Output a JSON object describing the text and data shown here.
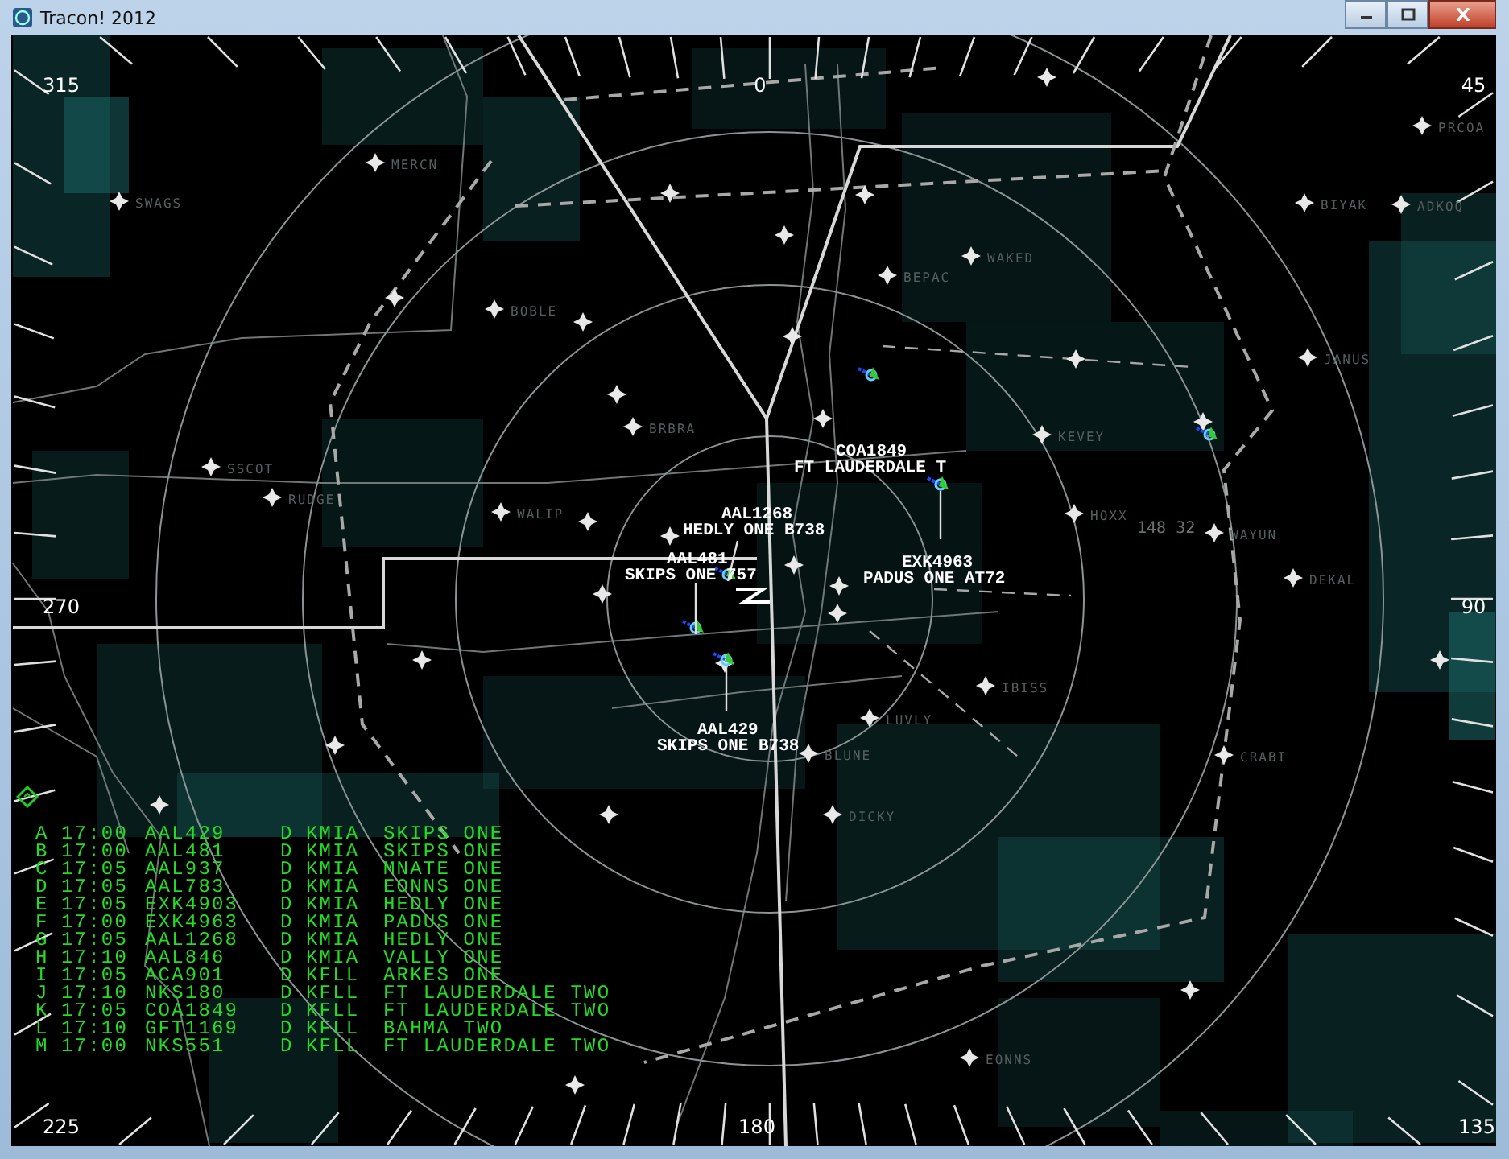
{
  "window": {
    "title": "Tracon! 2012"
  },
  "scope": {
    "bearing_labels": [
      "315",
      "0",
      "45",
      "270",
      "90",
      "225",
      "180",
      "135"
    ],
    "waypoints": [
      {
        "name": "SWAGS"
      },
      {
        "name": "MERCN"
      },
      {
        "name": "BOBLE"
      },
      {
        "name": "BRBRA"
      },
      {
        "name": "WAKED"
      },
      {
        "name": "BEPAC"
      },
      {
        "name": "PRCOA"
      },
      {
        "name": "BIYAK"
      },
      {
        "name": "ADKOQ"
      },
      {
        "name": "JANUS"
      },
      {
        "name": "KEVEY"
      },
      {
        "name": "HOXX"
      },
      {
        "name": "WAYUN"
      },
      {
        "name": "DEKAL"
      },
      {
        "name": "SSCOT"
      },
      {
        "name": "RUDGE"
      },
      {
        "name": "WALIP"
      },
      {
        "name": "IBISS"
      },
      {
        "name": "LUVLY"
      },
      {
        "name": "BLUNE"
      },
      {
        "name": "CRABI"
      },
      {
        "name": "DICKY"
      },
      {
        "name": "EONNS"
      }
    ],
    "annotation": "148 32",
    "aircraft": [
      {
        "callsign": "COA1849",
        "route": "FT LAUDERDALE T"
      },
      {
        "callsign": "AAL1268",
        "route": "HEDLY ONE B738"
      },
      {
        "callsign": "AAL481",
        "route": "SKIPS ONE 757"
      },
      {
        "callsign": "EXK4963",
        "route": "PADUS ONE AT72"
      },
      {
        "callsign": "AAL429",
        "route": "SKIPS ONE B738"
      }
    ]
  },
  "strip_list": [
    {
      "letter": "A",
      "time": "17:00",
      "callsign": "AAL429",
      "type": "D",
      "airport": "KMIA",
      "procedure": "SKIPS ONE"
    },
    {
      "letter": "B",
      "time": "17:00",
      "callsign": "AAL481",
      "type": "D",
      "airport": "KMIA",
      "procedure": "SKIPS ONE"
    },
    {
      "letter": "C",
      "time": "17:05",
      "callsign": "AAL937",
      "type": "D",
      "airport": "KMIA",
      "procedure": "MNATE ONE"
    },
    {
      "letter": "D",
      "time": "17:05",
      "callsign": "AAL783",
      "type": "D",
      "airport": "KMIA",
      "procedure": "EONNS ONE"
    },
    {
      "letter": "E",
      "time": "17:05",
      "callsign": "EXK4903",
      "type": "D",
      "airport": "KMIA",
      "procedure": "HEDLY ONE"
    },
    {
      "letter": "F",
      "time": "17:00",
      "callsign": "EXK4963",
      "type": "D",
      "airport": "KMIA",
      "procedure": "PADUS ONE"
    },
    {
      "letter": "G",
      "time": "17:05",
      "callsign": "AAL1268",
      "type": "D",
      "airport": "KMIA",
      "procedure": "HEDLY ONE"
    },
    {
      "letter": "H",
      "time": "17:10",
      "callsign": "AAL846",
      "type": "D",
      "airport": "KMIA",
      "procedure": "VALLY ONE"
    },
    {
      "letter": "I",
      "time": "17:05",
      "callsign": "ACA901",
      "type": "D",
      "airport": "KFLL",
      "procedure": "ARKES ONE"
    },
    {
      "letter": "J",
      "time": "17:10",
      "callsign": "NKS180",
      "type": "D",
      "airport": "KFLL",
      "procedure": "FT LAUDERDALE TWO"
    },
    {
      "letter": "K",
      "time": "17:05",
      "callsign": "COA1849",
      "type": "D",
      "airport": "KFLL",
      "procedure": "FT LAUDERDALE TWO"
    },
    {
      "letter": "L",
      "time": "17:10",
      "callsign": "GFT1169",
      "type": "D",
      "airport": "KFLL",
      "procedure": "BAHMA TWO"
    },
    {
      "letter": "M",
      "time": "17:00",
      "callsign": "NKS551",
      "type": "D",
      "airport": "KFLL",
      "procedure": "FT LAUDERDALE TWO"
    }
  ]
}
